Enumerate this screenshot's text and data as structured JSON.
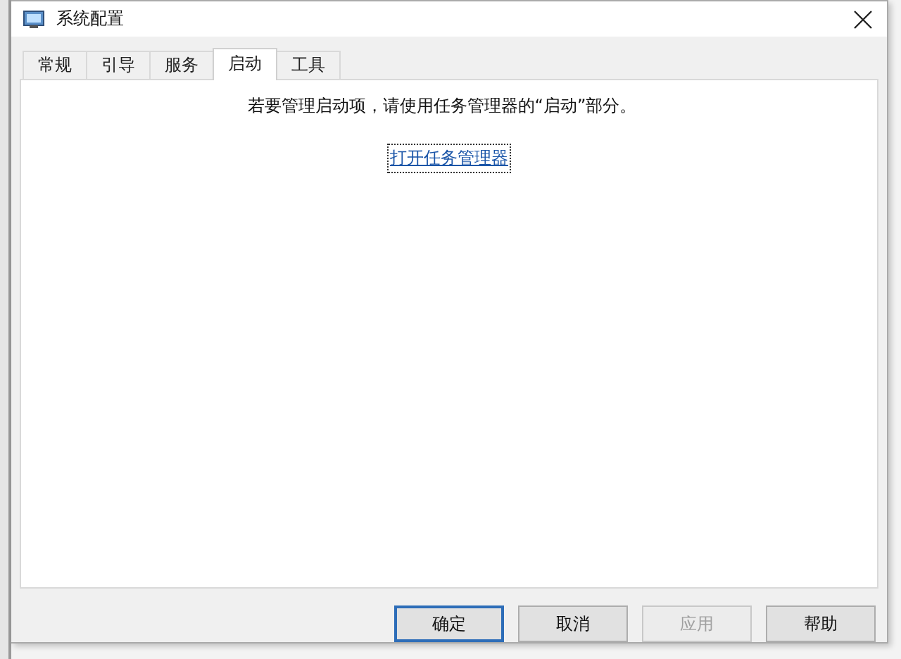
{
  "window": {
    "title": "系统配置"
  },
  "tabs": [
    {
      "label": "常规",
      "selected": false
    },
    {
      "label": "引导",
      "selected": false
    },
    {
      "label": "服务",
      "selected": false
    },
    {
      "label": "启动",
      "selected": true
    },
    {
      "label": "工具",
      "selected": false
    }
  ],
  "startup": {
    "message": "若要管理启动项，请使用任务管理器的“启动”部分。",
    "link": "打开任务管理器"
  },
  "buttons": [
    {
      "label": "确定",
      "default": true,
      "disabled": false
    },
    {
      "label": "取消",
      "default": false,
      "disabled": false
    },
    {
      "label": "应用",
      "default": false,
      "disabled": true
    },
    {
      "label": "帮助",
      "default": false,
      "disabled": false
    }
  ]
}
